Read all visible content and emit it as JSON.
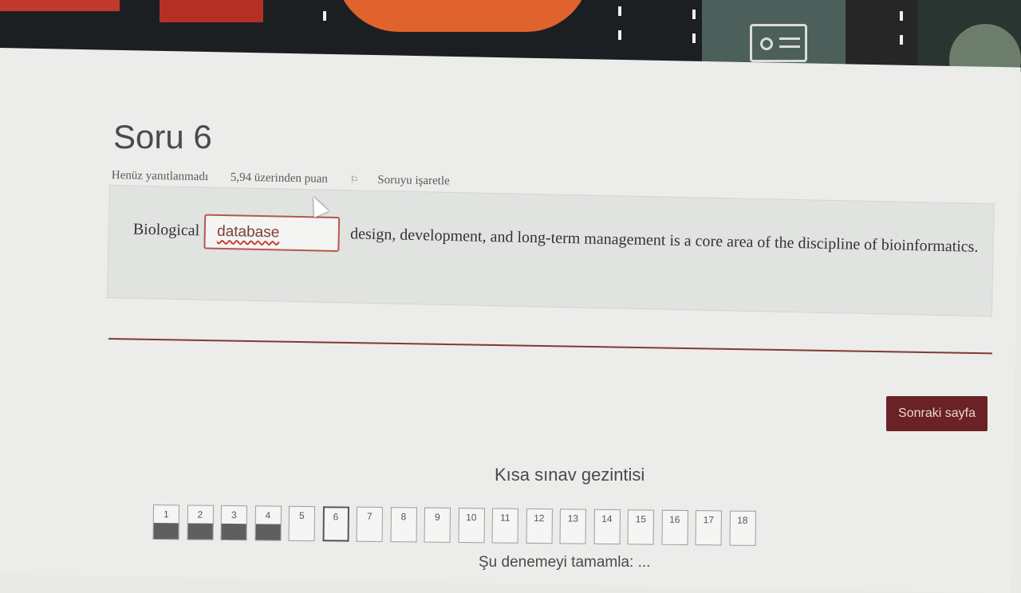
{
  "question": {
    "title": "Soru 6",
    "status": "Henüz yanıtlanmadı",
    "points": "5,94 üzerinden puan",
    "flag_label": "Soruyu işaretle",
    "text_before": "Biological",
    "answer_value": "database",
    "text_after": "design, development, and long-term management is a core area of the discipline of bioinformatics."
  },
  "actions": {
    "next_page": "Sonraki sayfa",
    "finish_attempt": "Şu denemeyi tamamla: ..."
  },
  "navigation": {
    "title": "Kısa sınav gezintisi",
    "items": [
      {
        "label": "1",
        "answered": true
      },
      {
        "label": "2",
        "answered": true
      },
      {
        "label": "3",
        "answered": true
      },
      {
        "label": "4",
        "answered": true
      },
      {
        "label": "5",
        "answered": false
      },
      {
        "label": "6",
        "answered": false,
        "current": true
      },
      {
        "label": "7",
        "answered": false
      },
      {
        "label": "8",
        "answered": false
      },
      {
        "label": "9",
        "answered": false
      },
      {
        "label": "10",
        "answered": false
      },
      {
        "label": "11",
        "answered": false
      },
      {
        "label": "12",
        "answered": false
      },
      {
        "label": "13",
        "answered": false
      },
      {
        "label": "14",
        "answered": false
      },
      {
        "label": "15",
        "answered": false
      },
      {
        "label": "16",
        "answered": false
      },
      {
        "label": "17",
        "answered": false
      },
      {
        "label": "18",
        "answered": false
      }
    ]
  },
  "colors": {
    "accent": "#6a2226",
    "answered_fill": "#5f5f5f",
    "banner_orange": "#e0632d"
  }
}
